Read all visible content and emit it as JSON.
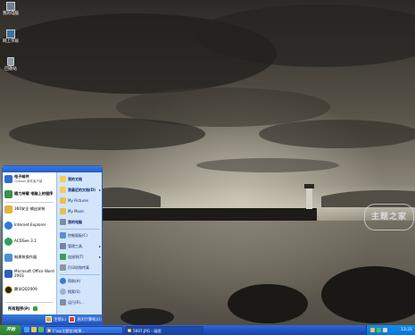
{
  "desktop": {
    "icons": [
      {
        "label": "我的电脑",
        "icon": "my-computer-icon"
      },
      {
        "label": "网上邻居",
        "icon": "network-places-icon"
      },
      {
        "label": "回收站",
        "icon": "recycle-bin-icon"
      }
    ],
    "watermark": "主题之家"
  },
  "start_menu": {
    "pinned": [
      {
        "label": "电子邮件",
        "sub": "Outlook 邮件客户端",
        "icon": "email-icon"
      },
      {
        "label": "随力持载 电脑上的程序",
        "sub": "",
        "icon": "transfer-icon"
      }
    ],
    "recent": [
      {
        "label": "360安全 输出安装",
        "icon": "security-icon"
      },
      {
        "label": "Internet Explorer",
        "icon": "internet-explorer-icon"
      },
      {
        "label": "ACDSee 3.1",
        "icon": "acdsee-icon"
      },
      {
        "label": "制建筑操作器",
        "icon": "tool-icon"
      },
      {
        "label": "Microsoft Office Word 2003",
        "icon": "word-icon"
      },
      {
        "label": "腾讯QQ2009",
        "icon": "qq-icon"
      }
    ],
    "all_programs": "所有程序(P)",
    "right": [
      {
        "label": "我的文档",
        "icon": "documents-icon",
        "bold": true,
        "arrow": ""
      },
      {
        "label": "我最近的文档(D)",
        "icon": "recent-docs-icon",
        "bold": true,
        "arrow": "▸"
      },
      {
        "label": "My Pictures",
        "icon": "pictures-icon",
        "bold": false,
        "arrow": ""
      },
      {
        "label": "My Music",
        "icon": "music-icon",
        "bold": false,
        "arrow": ""
      },
      {
        "label": "我的电脑",
        "icon": "computer-icon",
        "bold": true,
        "arrow": ""
      },
      {
        "label": "控制面板(C)",
        "icon": "control-panel-icon",
        "bold": false,
        "arrow": ""
      },
      {
        "label": "管理工具",
        "icon": "admin-tools-icon",
        "bold": false,
        "arrow": "▸"
      },
      {
        "label": "连接到(T)",
        "icon": "connect-icon",
        "bold": false,
        "arrow": "▸"
      },
      {
        "label": "打印机和传真",
        "icon": "printer-icon",
        "bold": false,
        "arrow": ""
      },
      {
        "label": "帮助(H)",
        "icon": "help-icon",
        "bold": false,
        "arrow": ""
      },
      {
        "label": "搜索(S)",
        "icon": "search-icon",
        "bold": false,
        "arrow": ""
      },
      {
        "label": "运行(R)...",
        "icon": "run-icon",
        "bold": false,
        "arrow": ""
      }
    ],
    "logoff": "注销(L)",
    "shutdown": "关闭计算机(U)"
  },
  "taskbar": {
    "start": "开始",
    "tasks": [
      {
        "label": "F:\\xp主题包\\效果...",
        "active": false
      },
      {
        "label": "5007.JPG - 画图",
        "active": true
      }
    ],
    "clock": "13:21"
  },
  "colors": {
    "taskbar": "#245ad0",
    "start_button": "#3c9a3c",
    "tray": "#0f8ff0"
  }
}
